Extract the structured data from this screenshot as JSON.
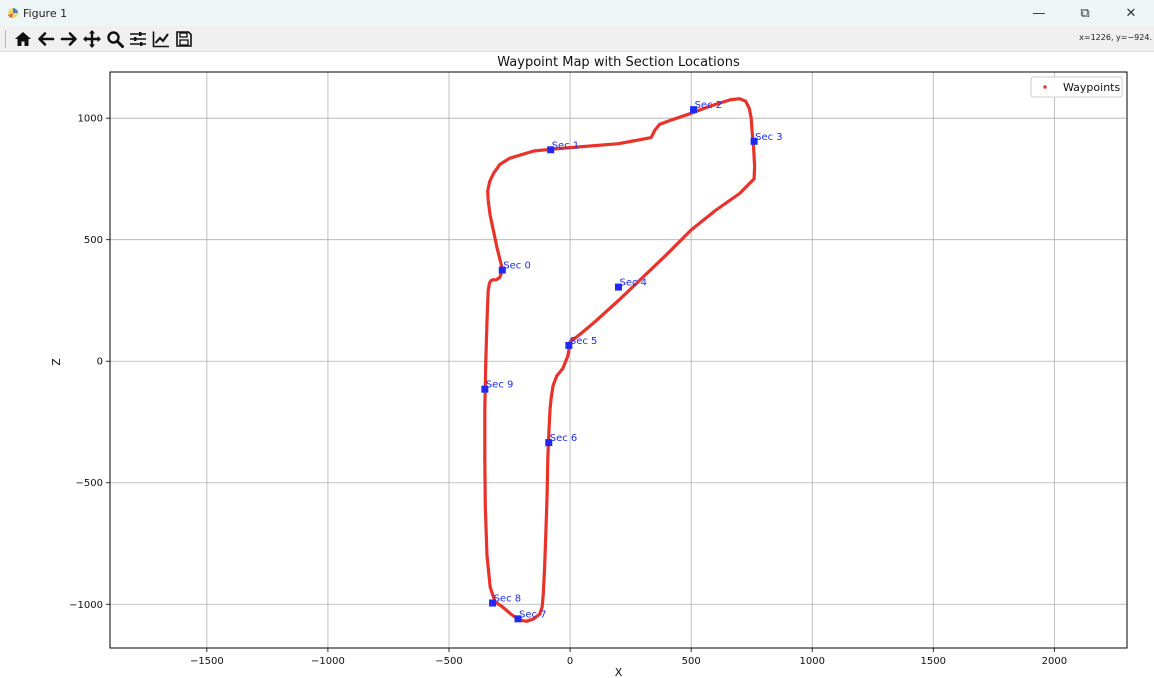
{
  "window": {
    "title": "Figure 1",
    "minimize_glyph": "—",
    "restore_glyph": "⧉",
    "close_glyph": "✕"
  },
  "toolbar": {
    "tools": [
      {
        "name": "home",
        "icon": "home-icon"
      },
      {
        "name": "back",
        "icon": "arrow-left-icon"
      },
      {
        "name": "forward",
        "icon": "arrow-right-icon"
      },
      {
        "name": "pan",
        "icon": "move-icon"
      },
      {
        "name": "zoom",
        "icon": "zoom-icon"
      },
      {
        "name": "configure-subplots",
        "icon": "sliders-icon"
      },
      {
        "name": "edit-axis",
        "icon": "line-chart-icon"
      },
      {
        "name": "save",
        "icon": "save-icon"
      }
    ],
    "coords": "x=1226, y=−924."
  },
  "chart_data": {
    "type": "scatter",
    "title": "Waypoint Map with Section Locations",
    "xlabel": "X",
    "ylabel": "Z",
    "xlim": [
      -1900,
      2300
    ],
    "ylim": [
      -1180,
      1190
    ],
    "xticks": [
      -1500,
      -1000,
      -500,
      0,
      500,
      1000,
      1500,
      2000
    ],
    "yticks": [
      -1000,
      -500,
      0,
      500,
      1000
    ],
    "grid": true,
    "legend": {
      "position": "top-right",
      "entries": [
        {
          "label": "Waypoints",
          "color": "#e8322a"
        }
      ]
    },
    "waypoint_color": "#e8322a",
    "section_color": "#1f2bf2",
    "waypoints": {
      "x": [
        -280,
        -300,
        -315,
        -330,
        -338,
        -340,
        -332,
        -315,
        -290,
        -250,
        -200,
        -150,
        -80,
        50,
        200,
        335,
        350,
        370,
        420,
        500,
        580,
        660,
        700,
        725,
        740,
        748,
        752,
        758,
        762,
        760,
        700,
        600,
        500,
        400,
        300,
        200,
        100,
        40,
        0,
        -2,
        -10,
        -30,
        -55,
        -70,
        -78,
        -83,
        -88,
        -92,
        -95,
        -100,
        -105,
        -110,
        -115,
        -125,
        -150,
        -180,
        -210,
        -245,
        -280,
        -310,
        -330,
        -343,
        -350,
        -352,
        -352,
        -350,
        -348,
        -345,
        -342,
        -338,
        -333,
        -328,
        -320,
        -305,
        -290,
        -285,
        -280
      ],
      "y": [
        380,
        460,
        530,
        600,
        660,
        700,
        740,
        775,
        810,
        835,
        850,
        865,
        872,
        883,
        895,
        920,
        950,
        975,
        993,
        1020,
        1050,
        1075,
        1080,
        1070,
        1040,
        1000,
        940,
        880,
        800,
        750,
        690,
        620,
        540,
        440,
        345,
        250,
        160,
        110,
        80,
        60,
        20,
        -30,
        -60,
        -100,
        -150,
        -200,
        -300,
        -400,
        -550,
        -700,
        -850,
        -950,
        -1010,
        -1040,
        -1060,
        -1070,
        -1065,
        -1040,
        -1010,
        -990,
        -930,
        -800,
        -600,
        -400,
        -200,
        -100,
        0,
        100,
        200,
        290,
        320,
        330,
        335,
        335,
        345,
        360,
        380
      ]
    },
    "sections": [
      {
        "label": "Sec 0",
        "x": -280,
        "y": 375
      },
      {
        "label": "Sec 1",
        "x": -80,
        "y": 870
      },
      {
        "label": "Sec 2",
        "x": 510,
        "y": 1035
      },
      {
        "label": "Sec 3",
        "x": 760,
        "y": 905
      },
      {
        "label": "Sec 4",
        "x": 200,
        "y": 305
      },
      {
        "label": "Sec 5",
        "x": -5,
        "y": 65
      },
      {
        "label": "Sec 6",
        "x": -88,
        "y": -335
      },
      {
        "label": "Sec 7",
        "x": -215,
        "y": -1060
      },
      {
        "label": "Sec 8",
        "x": -320,
        "y": -995
      },
      {
        "label": "Sec 9",
        "x": -352,
        "y": -115
      }
    ]
  }
}
